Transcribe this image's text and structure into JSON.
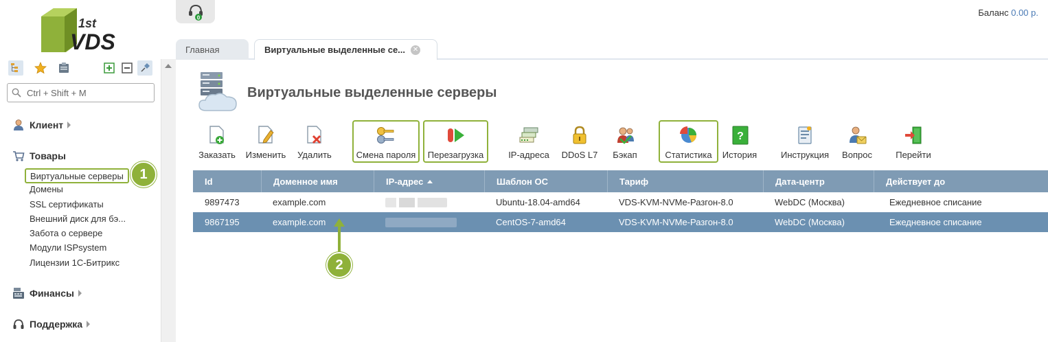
{
  "logo": {
    "text_top": "1st",
    "text_main": "VDS",
    "color": "#8fb13a"
  },
  "sidebar": {
    "search_placeholder": "Ctrl + Shift + M",
    "toolbar_icons": [
      "tree-icon",
      "star-icon",
      "clipboard-icon",
      "expand-icon",
      "collapse-icon",
      "pin-icon"
    ],
    "sections": [
      {
        "label": "Клиент",
        "icon": "user-icon"
      },
      {
        "label": "Товары",
        "icon": "cart-icon",
        "items": [
          "Виртуальные серверы",
          "Домены",
          "SSL сертификаты",
          "Внешний диск для бэ...",
          "Забота о сервере",
          "Модули ISPsystem",
          "Лицензии 1С-Битрикс"
        ]
      },
      {
        "label": "Финансы",
        "icon": "cash-register-icon"
      },
      {
        "label": "Поддержка",
        "icon": "headset-icon"
      }
    ]
  },
  "header": {
    "balance_label": "Баланс",
    "balance_value": "0.00 р.",
    "notification_count": "0"
  },
  "tabs": [
    {
      "label": "Главная",
      "active": false
    },
    {
      "label": "Виртуальные выделенные се...",
      "active": true
    }
  ],
  "page": {
    "title": "Виртуальные выделенные серверы"
  },
  "toolbar": [
    {
      "label": "Заказать",
      "icon": "order-icon",
      "highlight": false
    },
    {
      "label": "Изменить",
      "icon": "edit-icon",
      "highlight": false
    },
    {
      "label": "Удалить",
      "icon": "delete-icon",
      "highlight": false
    },
    {
      "label": "Смена пароля",
      "icon": "key-icon",
      "highlight": true
    },
    {
      "label": "Перезагрузка",
      "icon": "reboot-icon",
      "highlight": true
    },
    {
      "label": "IP-адреса",
      "icon": "ip-icon",
      "highlight": false
    },
    {
      "label": "DDoS L7",
      "icon": "lock-icon",
      "highlight": false
    },
    {
      "label": "Бэкап",
      "icon": "backup-icon",
      "highlight": false
    },
    {
      "label": "Статистика",
      "icon": "pie-chart-icon",
      "highlight": true
    },
    {
      "label": "История",
      "icon": "history-icon",
      "highlight": false
    },
    {
      "label": "Инструкция",
      "icon": "instruction-icon",
      "highlight": false
    },
    {
      "label": "Вопрос",
      "icon": "question-icon",
      "highlight": false
    },
    {
      "label": "Перейти",
      "icon": "goto-icon",
      "highlight": false
    }
  ],
  "table": {
    "columns": [
      "Id",
      "Доменное имя",
      "IP-адрес",
      "Шаблон ОС",
      "Тариф",
      "Дата-центр",
      "Действует до"
    ],
    "sort_column": "IP-адрес",
    "rows": [
      {
        "id": "9897473",
        "domain": "example.com",
        "ip": "",
        "os": "Ubuntu-18.04-amd64",
        "tariff": "VDS-KVM-NVMe-Разгон-8.0",
        "dc": "WebDC (Москва)",
        "until": "Ежедневное списание",
        "selected": false
      },
      {
        "id": "9867195",
        "domain": "example.com",
        "ip": "",
        "os": "CentOS-7-amd64",
        "tariff": "VDS-KVM-NVMe-Разгон-8.0",
        "dc": "WebDC (Москва)",
        "until": "Ежедневное списание",
        "selected": true
      }
    ]
  },
  "annotations": {
    "badge1": "1",
    "badge2": "2"
  },
  "colors": {
    "accent": "#8fb13a",
    "header_bg": "#7f9bb4",
    "selected_bg": "#6b90b1",
    "link": "#4a7ab5"
  }
}
